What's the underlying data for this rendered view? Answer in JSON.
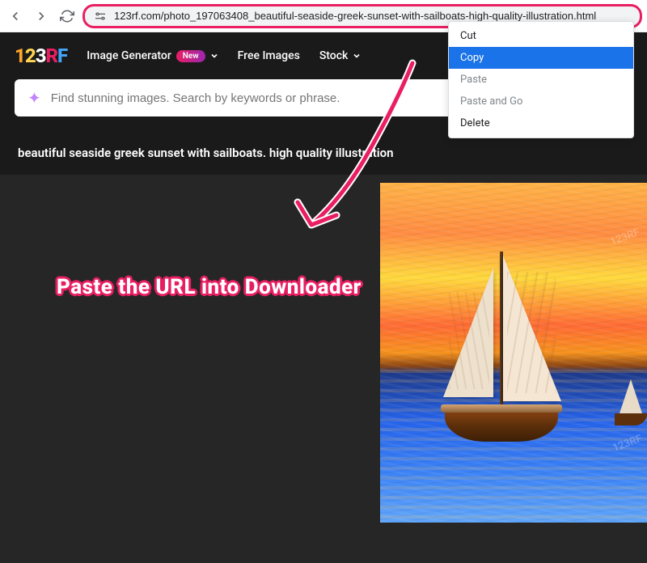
{
  "browser": {
    "url": "123rf.com/photo_197063408_beautiful-seaside-greek-sunset-with-sailboats-high-quality-illustration.html"
  },
  "context_menu": {
    "items": [
      {
        "label": "Cut",
        "highlighted": false,
        "disabled": false
      },
      {
        "label": "Copy",
        "highlighted": true,
        "disabled": false
      },
      {
        "label": "Paste",
        "highlighted": false,
        "disabled": true
      },
      {
        "label": "Paste and Go",
        "highlighted": false,
        "disabled": true
      },
      {
        "label": "Delete",
        "highlighted": false,
        "disabled": false
      }
    ]
  },
  "header": {
    "logo_parts": {
      "p1": "1",
      "p2": "2",
      "p3": "3",
      "r": "R",
      "f": "F"
    },
    "nav": [
      {
        "label": "Image Generator",
        "badge": "New",
        "has_chevron": true
      },
      {
        "label": "Free Images",
        "badge": null,
        "has_chevron": false
      },
      {
        "label": "Stock",
        "badge": null,
        "has_chevron": true
      }
    ]
  },
  "search": {
    "placeholder": "Find stunning images. Search by keywords or phrase."
  },
  "page_title": "beautiful seaside greek sunset with sailboats. high quality illustration",
  "watermark_text": "123RF",
  "instruction_text": "Paste the URL into Downloader"
}
